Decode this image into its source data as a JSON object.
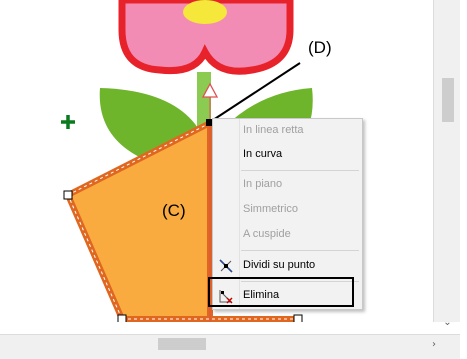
{
  "callouts": {
    "d": "(D)",
    "c": "(C)"
  },
  "context_menu": {
    "items": [
      {
        "label": "In linea retta",
        "enabled": false
      },
      {
        "label": "In curva",
        "enabled": true
      },
      {
        "label": "In piano",
        "enabled": false
      },
      {
        "label": "Simmetrico",
        "enabled": false
      },
      {
        "label": "A cuspide",
        "enabled": false
      },
      {
        "label": "Dividi su punto",
        "enabled": true,
        "icon": "split-point-icon"
      },
      {
        "label": "Elimina",
        "enabled": true,
        "icon": "delete-point-icon",
        "highlighted": true
      }
    ]
  },
  "colors": {
    "petal": "#f28cb4",
    "petal_outline": "#e8222a",
    "leaf": "#6fb52c",
    "shape_fill": "#f9ab40",
    "shape_outline": "#e0671f",
    "stem": "#8ccb52",
    "guide": "#e05050"
  },
  "scrollbars": {
    "down_arrow": "⌄",
    "right_arrow": "›"
  }
}
